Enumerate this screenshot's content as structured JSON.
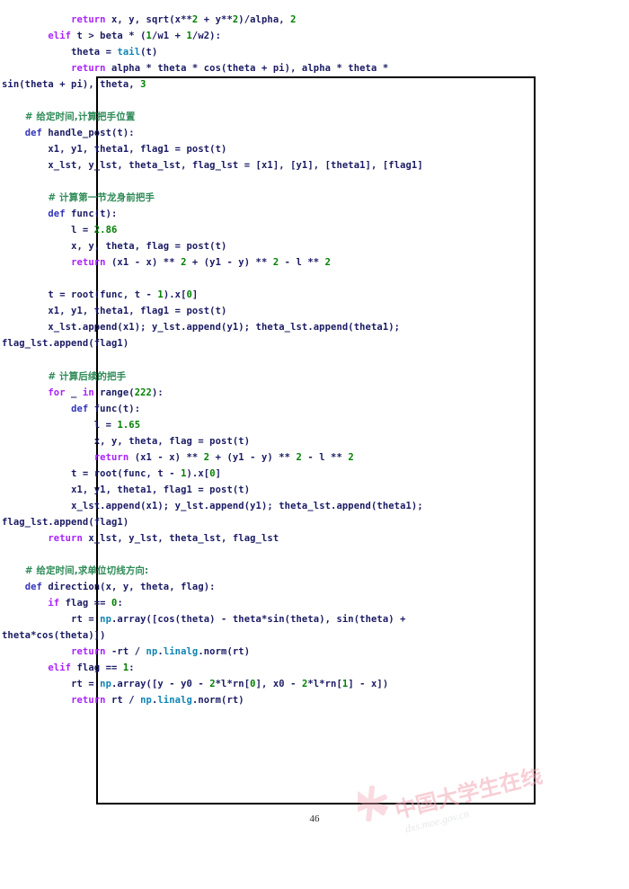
{
  "document": {
    "page_number": "46",
    "watermark": {
      "text": "中国大学生在线",
      "url": "dxs.moe.gov.cn",
      "color": "#f2b8c0"
    },
    "frame": {
      "border_color": "#000000"
    }
  },
  "code": {
    "language": "python",
    "colors": {
      "keyword": "#aa22ff",
      "def_keyword": "#3333bb",
      "number": "#008000",
      "comment": "#2e8b57",
      "module": "#0e84b5",
      "identifier": "#19197f"
    },
    "lines": [
      "            return x, y, sqrt(x**2 + y**2)/alpha, 2",
      "        elif t > beta * (1/w1 + 1/w2):",
      "            theta = tail(t)",
      "            return alpha * theta * cos(theta + pi), alpha * theta * sin(theta + pi), theta, 3",
      "",
      "    # 给定时间,计算把手位置",
      "    def handle_post(t):",
      "        x1, y1, theta1, flag1 = post(t)",
      "        x_lst, y_lst, theta_lst, flag_lst = [x1], [y1], [theta1], [flag1]",
      "",
      "        # 计算第一节龙身前把手",
      "        def func(t):",
      "            l = 2.86",
      "            x, y, theta, flag = post(t)",
      "            return (x1 - x) ** 2 + (y1 - y) ** 2 - l ** 2",
      "",
      "        t = root(func, t - 1).x[0]",
      "        x1, y1, theta1, flag1 = post(t)",
      "        x_lst.append(x1); y_lst.append(y1); theta_lst.append(theta1); flag_lst.append(flag1)",
      "",
      "        # 计算后续的把手",
      "        for _ in range(222):",
      "            def func(t):",
      "                l = 1.65",
      "                x, y, theta, flag = post(t)",
      "                return (x1 - x) ** 2 + (y1 - y) ** 2 - l ** 2",
      "            t = root(func, t - 1).x[0]",
      "            x1, y1, theta1, flag1 = post(t)",
      "            x_lst.append(x1); y_lst.append(y1); theta_lst.append(theta1); flag_lst.append(flag1)",
      "        return x_lst, y_lst, theta_lst, flag_lst",
      "",
      "    # 给定时间,求单位切线方向:",
      "    def direction(x, y, theta, flag):",
      "        if flag == 0:",
      "            rt = np.array([cos(theta) - theta*sin(theta), sin(theta) + theta*cos(theta)])",
      "            return -rt / np.linalg.norm(rt)",
      "        elif flag == 1:",
      "            rt = np.array([y - y0 - 2*l*rn[0], x0 - 2*l*rn[1] - x])",
      "            return rt / np.linalg.norm(rt)"
    ]
  }
}
